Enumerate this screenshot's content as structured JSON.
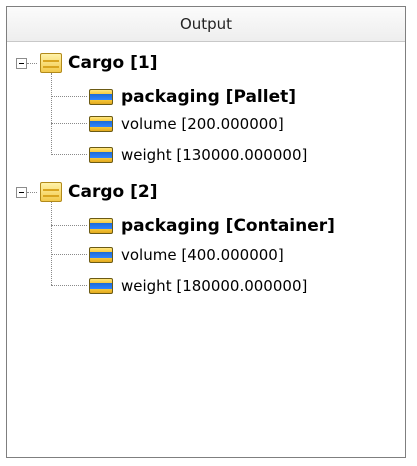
{
  "panel": {
    "title": "Output"
  },
  "tree": {
    "nodes": [
      {
        "label": "Cargo [1]",
        "expanded": true,
        "children": [
          {
            "label": "packaging [Pallet]",
            "bold": true
          },
          {
            "label": "volume [200.000000]",
            "bold": false
          },
          {
            "label": "weight [130000.000000]",
            "bold": false
          }
        ]
      },
      {
        "label": "Cargo [2]",
        "expanded": true,
        "children": [
          {
            "label": "packaging [Container]",
            "bold": true
          },
          {
            "label": "volume [400.000000]",
            "bold": false
          },
          {
            "label": "weight [180000.000000]",
            "bold": false
          }
        ]
      }
    ]
  },
  "icons": {
    "expander": "collapse-minus-icon",
    "group": "folder-icon",
    "field": "field-icon"
  }
}
